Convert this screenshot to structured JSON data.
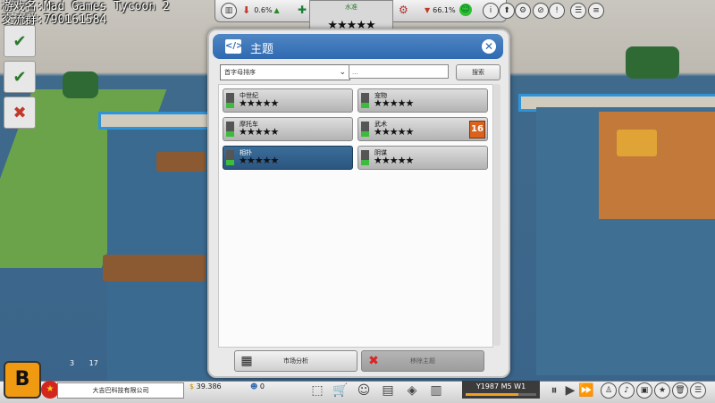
{
  "overlay": {
    "line1": "游戏名:Mad Games Tycoon 2",
    "line2": "交流群:790161584"
  },
  "topbar": {
    "fans_pct": "0.6%",
    "rating_label": "水准",
    "rating_stars": "★★★★★",
    "hype_pct": "66.1%"
  },
  "dialog": {
    "title": "主题",
    "code_icon": "</>",
    "sort_value": "首字母排序",
    "search_placeholder": "...",
    "search_label": "搜索",
    "themes": [
      {
        "name": "中世纪",
        "stars": "★★★★★",
        "selected": false
      },
      {
        "name": "宠物",
        "stars": "★★★★★",
        "selected": false
      },
      {
        "name": "摩托车",
        "stars": "★★★★★",
        "selected": false
      },
      {
        "name": "武术",
        "stars": "★★★★★",
        "selected": false,
        "age_rating": "16"
      },
      {
        "name": "相扑",
        "stars": "★★★★★",
        "selected": true
      },
      {
        "name": "阴谋",
        "stars": "★★★★★",
        "selected": false
      }
    ],
    "market_button": "市场分析",
    "remove_button": "移除主题"
  },
  "bottom": {
    "company": "大吉巴科技有限公司",
    "money": "39.386",
    "fans": "0",
    "employees_a": "3",
    "employees_b": "17",
    "date": "Y1987 M5 W1",
    "date_progress": 0.75
  },
  "colors": {
    "accent": "#2f69b0",
    "selected_row": "#2b5680",
    "wall_trim": "#2f93d8"
  }
}
